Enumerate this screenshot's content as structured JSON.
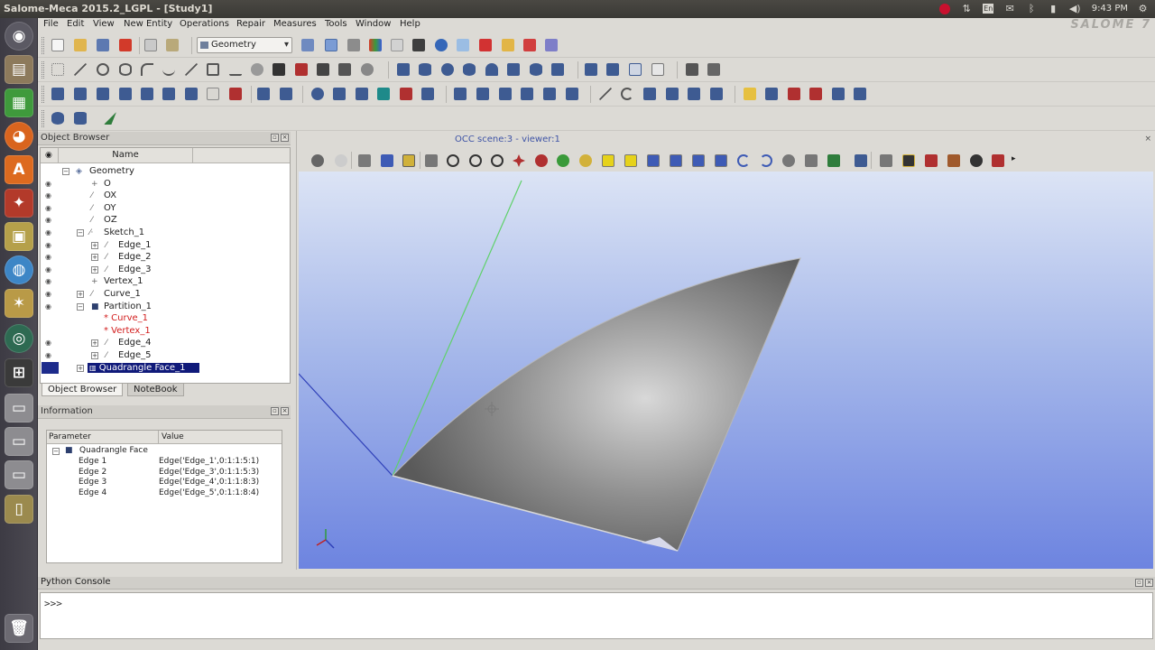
{
  "window": {
    "title": "Salome-Meca 2015.2_LGPL - [Study1]"
  },
  "system_tray": {
    "time": "9:43 PM"
  },
  "brand": {
    "logo_text": "SALOME 7"
  },
  "menubar": {
    "items": [
      "File",
      "Edit",
      "View",
      "New Entity",
      "Operations",
      "Repair",
      "Measures",
      "Tools",
      "Window",
      "Help"
    ]
  },
  "toolbar": {
    "module_combo_value": "Geometry"
  },
  "object_browser": {
    "title": "Object Browser",
    "column_name": "Name",
    "rows": [
      {
        "label": "Geometry"
      },
      {
        "label": "O"
      },
      {
        "label": "OX"
      },
      {
        "label": "OY"
      },
      {
        "label": "OZ"
      },
      {
        "label": "Sketch_1"
      },
      {
        "label": "Edge_1"
      },
      {
        "label": "Edge_2"
      },
      {
        "label": "Edge_3"
      },
      {
        "label": "Vertex_1"
      },
      {
        "label": "Curve_1"
      },
      {
        "label": "Partition_1"
      },
      {
        "label": "* Curve_1"
      },
      {
        "label": "* Vertex_1"
      },
      {
        "label": "Edge_4"
      },
      {
        "label": "Edge_5"
      },
      {
        "label": "Quadrangle Face_1"
      }
    ],
    "tabs": [
      "Object Browser",
      "NoteBook"
    ]
  },
  "information": {
    "title": "Information",
    "col_parameter": "Parameter",
    "col_value": "Value",
    "group": "Quadrangle Face",
    "rows": [
      {
        "param": "Edge 1",
        "value": "Edge('Edge_1',0:1:1:5:1)"
      },
      {
        "param": "Edge 2",
        "value": "Edge('Edge_3',0:1:1:5:3)"
      },
      {
        "param": "Edge 3",
        "value": "Edge('Edge_4',0:1:1:8:3)"
      },
      {
        "param": "Edge 4",
        "value": "Edge('Edge_5',0:1:1:8:4)"
      }
    ]
  },
  "viewer": {
    "title": "OCC scene:3 - viewer:1"
  },
  "python_console": {
    "title": "Python Console",
    "prompt": ">>>"
  },
  "colors": {
    "scene_top": "#dce4f5",
    "scene_bottom": "#6d84e0",
    "selection": "#101a7a",
    "face": "#8a8a8a"
  }
}
